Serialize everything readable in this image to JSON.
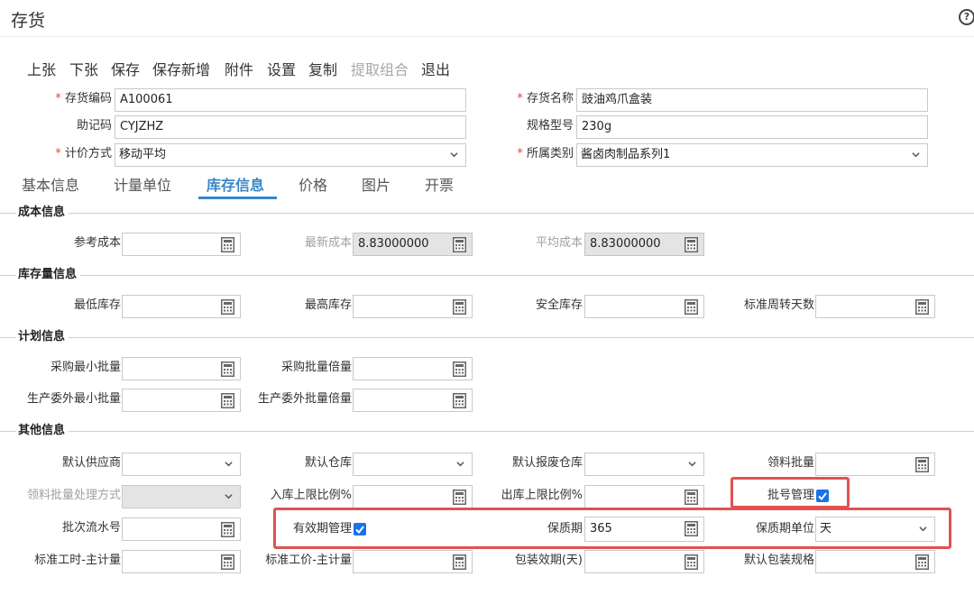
{
  "page": {
    "title": "存货"
  },
  "toolbar": [
    "上张",
    "下张",
    "保存",
    "保存新增",
    "附件",
    "设置",
    "复制",
    "提取组合",
    "退出"
  ],
  "header": {
    "inventory_code_label": "存货编码",
    "inventory_code_value": "A100061",
    "inventory_name_label": "存货名称",
    "inventory_name_value": "豉油鸡爪盒装",
    "mnemonic_label": "助记码",
    "mnemonic_value": "CYJZHZ",
    "spec_label": "规格型号",
    "spec_value": "230g",
    "pricing_label": "计价方式",
    "pricing_value": "移动平均",
    "category_label": "所属类别",
    "category_value": "酱卤肉制品系列1"
  },
  "tabs": [
    "基本信息",
    "计量单位",
    "库存信息",
    "价格",
    "图片",
    "开票"
  ],
  "active_tab": "库存信息",
  "cost_section": {
    "title": "成本信息",
    "ref_cost_label": "参考成本",
    "latest_cost_label": "最新成本",
    "latest_cost_value": "8.83000000",
    "avg_cost_label": "平均成本",
    "avg_cost_value": "8.83000000"
  },
  "stock_section": {
    "title": "库存量信息",
    "min_stock_label": "最低库存",
    "max_stock_label": "最高库存",
    "safety_stock_label": "安全库存",
    "turnover_days_label": "标准周转天数"
  },
  "plan_section": {
    "title": "计划信息",
    "purchase_min_label": "采购最小批量",
    "purchase_multiple_label": "采购批量倍量",
    "outsource_min_label": "生产委外最小批量",
    "outsource_multiple_label": "生产委外批量倍量"
  },
  "other_section": {
    "title": "其他信息",
    "default_supplier_label": "默认供应商",
    "default_warehouse_label": "默认仓库",
    "default_scrap_warehouse_label": "默认报废仓库",
    "material_batch_label": "领料批量",
    "material_batch_method_label": "领料批量处理方式",
    "inbound_limit_label": "入库上限比例%",
    "outbound_limit_label": "出库上限比例%",
    "batch_mgmt_label": "批号管理",
    "batch_serial_label": "批次流水号",
    "expiry_mgmt_label": "有效期管理",
    "shelf_life_label": "保质期",
    "shelf_life_value": "365",
    "shelf_life_unit_label": "保质期单位",
    "shelf_life_unit_value": "天",
    "std_hours_label": "标准工时-主计量",
    "std_price_label": "标准工价-主计量",
    "pack_validity_label": "包装效期(天)",
    "default_pack_label": "默认包装规格"
  },
  "colors": {
    "accent": "#3a86c8",
    "highlight": "#e05252",
    "checkbox": "#1a73e8",
    "required": "#e0473b"
  }
}
